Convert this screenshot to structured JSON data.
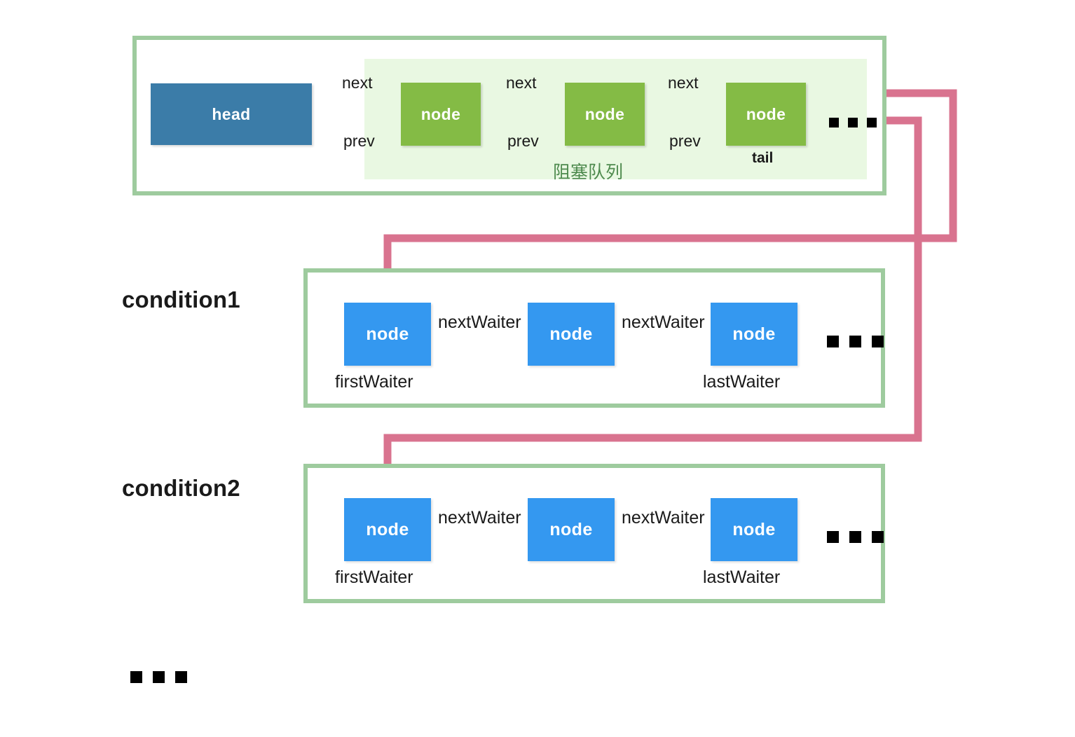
{
  "diagram": {
    "title": "AQS condition queues and blocking queue",
    "colors": {
      "frame_border": "#9ecb9e",
      "queue_highlight": "#e9f8e2",
      "head_box": "#3b7ca8",
      "green_node": "#84bb45",
      "blue_node": "#3498f0",
      "green_arrow": "#8fc99a",
      "pink_arrow": "#d9738f",
      "black_arrow": "#000000",
      "chinese_label": "#4e8a4e"
    }
  },
  "queue": {
    "chinese_label": "阻塞队列",
    "head_label": "head",
    "tail_label": "tail",
    "nodes": [
      {
        "label": "node"
      },
      {
        "label": "node"
      },
      {
        "label": "node"
      }
    ],
    "links": [
      {
        "next": "next",
        "prev": "prev"
      },
      {
        "next": "next",
        "prev": "prev"
      },
      {
        "next": "next",
        "prev": "prev"
      }
    ],
    "ellipsis": "..."
  },
  "conditions": [
    {
      "name": "condition1",
      "first_waiter_label": "firstWaiter",
      "last_waiter_label": "lastWaiter",
      "nodes": [
        {
          "label": "node"
        },
        {
          "label": "node"
        },
        {
          "label": "node"
        }
      ],
      "links": [
        {
          "label": "nextWaiter"
        },
        {
          "label": "nextWaiter"
        }
      ],
      "ellipsis": "..."
    },
    {
      "name": "condition2",
      "first_waiter_label": "firstWaiter",
      "last_waiter_label": "lastWaiter",
      "nodes": [
        {
          "label": "node"
        },
        {
          "label": "node"
        },
        {
          "label": "node"
        }
      ],
      "links": [
        {
          "label": "nextWaiter"
        },
        {
          "label": "nextWaiter"
        }
      ],
      "ellipsis": "..."
    }
  ],
  "more_conditions_ellipsis": "..."
}
